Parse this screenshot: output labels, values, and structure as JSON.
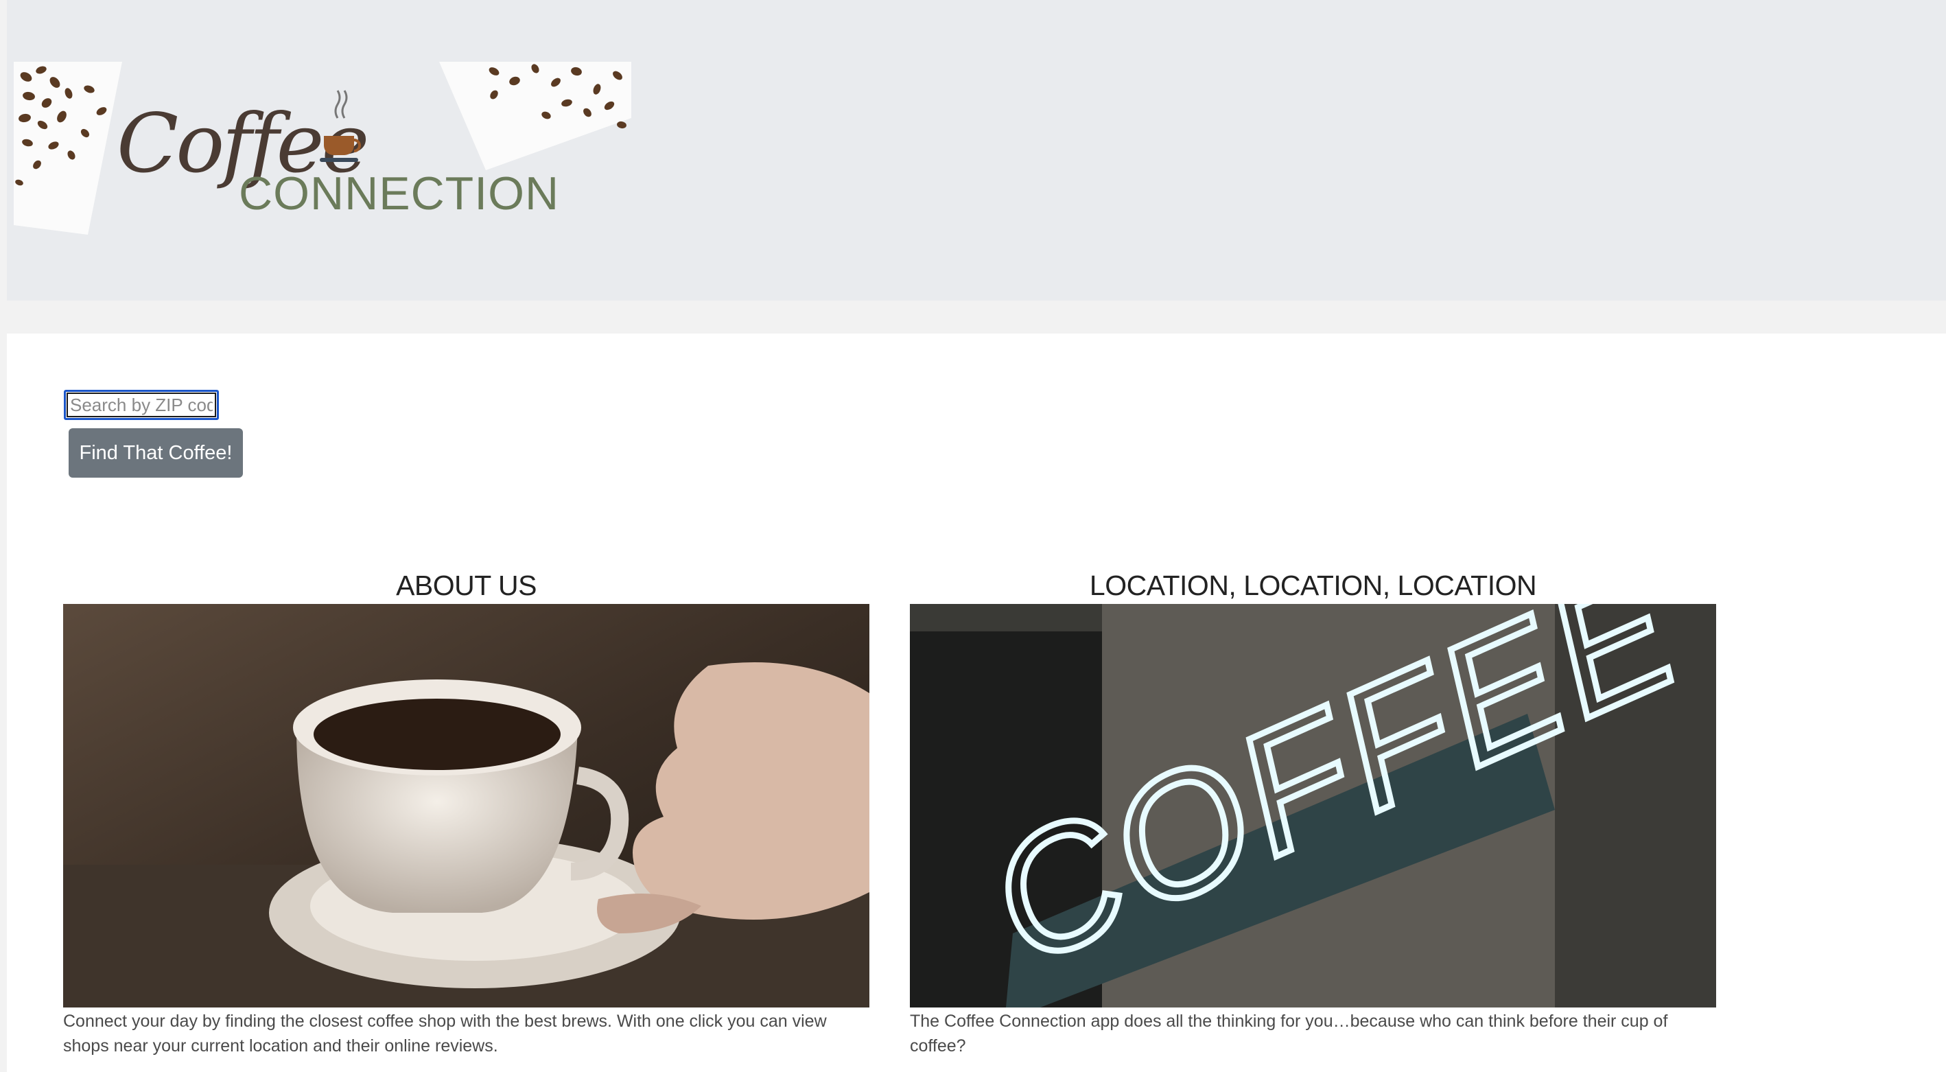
{
  "brand": {
    "logo_word_1": "Coffee",
    "logo_word_2": "CONNECTION"
  },
  "search": {
    "placeholder": "Search by ZIP code",
    "value": "",
    "button_label": "Find That Coffee!"
  },
  "sections": {
    "about": {
      "heading": "ABOUT US",
      "image": "coffee-cup-photo",
      "text": "Connect your day by finding the closest coffee shop with the best brews. With one click you can view shops near your current location and their online reviews."
    },
    "location": {
      "heading": "LOCATION, LOCATION, LOCATION",
      "image": "neon-coffee-sign-photo",
      "sign_text": "COFFEE",
      "text": "The Coffee Connection app does all the thinking for you…because who can think before their cup of coffee?"
    }
  },
  "colors": {
    "header_bg": "#e9ebee",
    "button_bg": "#6c757d",
    "logo_brown": "#4a3b33",
    "logo_green": "#6b7b5a"
  }
}
